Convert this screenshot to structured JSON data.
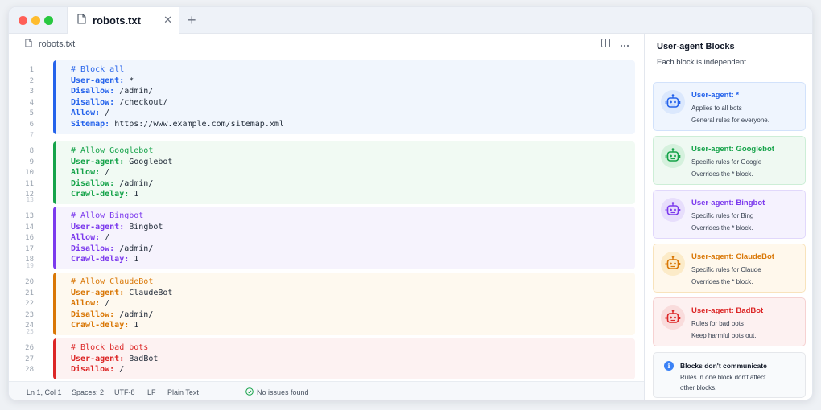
{
  "tab": {
    "title": "robots.txt",
    "close": "✕",
    "new": "+"
  },
  "breadcrumb": {
    "file": "robots.txt"
  },
  "colors": {
    "blue": "#2563eb",
    "green": "#16a34a",
    "purple": "#7c3aed",
    "orange": "#d97706",
    "red": "#dc2626"
  },
  "editor": {
    "blocks": [
      {
        "color": "blue",
        "lines": [
          {
            "n": "1",
            "comment": "# Block all"
          },
          {
            "n": "2",
            "key": "User-agent:",
            "value": " *"
          },
          {
            "n": "3",
            "key": "Disallow:",
            "value": " /admin/"
          },
          {
            "n": "4",
            "key": "Disallow:",
            "value": " /checkout/"
          },
          {
            "n": "5",
            "key": "Allow:",
            "value": " /"
          },
          {
            "n": "6",
            "key": "Sitemap:",
            "value": " https://www.example.com/sitemap.xml"
          }
        ]
      },
      {
        "color": "green",
        "lines": [
          {
            "n": "8",
            "comment": "# Allow Googlebot"
          },
          {
            "n": "9",
            "key": "User-agent:",
            "value": " Googlebot"
          },
          {
            "n": "10",
            "key": "Allow:",
            "value": " /"
          },
          {
            "n": "11",
            "key": "Disallow:",
            "value": " /admin/"
          },
          {
            "n": "12",
            "key": "Crawl-delay:",
            "value": " 1"
          }
        ]
      },
      {
        "color": "purple",
        "lines": [
          {
            "n": "13",
            "comment": "# Allow Bingbot"
          },
          {
            "n": "14",
            "key": "User-agent:",
            "value": " Bingbot"
          },
          {
            "n": "16",
            "key": "Allow:",
            "value": " /"
          },
          {
            "n": "17",
            "key": "Disallow:",
            "value": " /admin/"
          },
          {
            "n": "18",
            "key": "Crawl-delay:",
            "value": " 1"
          }
        ]
      },
      {
        "color": "orange",
        "lines": [
          {
            "n": "20",
            "comment": "# Allow ClaudeBot"
          },
          {
            "n": "21",
            "key": "User-agent:",
            "value": " ClaudeBot"
          },
          {
            "n": "22",
            "key": "Allow:",
            "value": " /"
          },
          {
            "n": "23",
            "key": "Disallow:",
            "value": " /admin/"
          },
          {
            "n": "24",
            "key": "Crawl-delay:",
            "value": " 1"
          }
        ]
      },
      {
        "color": "red",
        "lines": [
          {
            "n": "26",
            "comment": "# Block bad bots"
          },
          {
            "n": "27",
            "key": "User-agent:",
            "value": " BadBot"
          },
          {
            "n": "28",
            "key": "Disallow:",
            "value": " /"
          }
        ]
      }
    ],
    "gap_numbers": [
      "7",
      "13",
      "19",
      "25"
    ]
  },
  "status": {
    "position": "Ln 1, Col 1",
    "spaces": "Spaces: 2",
    "encoding": "UTF-8",
    "eol": "LF",
    "language": "Plain Text",
    "issues": "No issues found"
  },
  "panel": {
    "title": "User-agent Blocks",
    "subtitle": "Each block is independent",
    "cards": [
      {
        "color": "blue",
        "title": "User-agent: *",
        "line1": "Applies to all bots",
        "line2": "General rules for everyone."
      },
      {
        "color": "green",
        "title": "User-agent: Googlebot",
        "line1": "Specific rules for Google",
        "line2": "Overrides the * block."
      },
      {
        "color": "purple",
        "title": "User-agent: Bingbot",
        "line1": "Specific rules for Bing",
        "line2": "Overrides the * block."
      },
      {
        "color": "orange",
        "title": "User-agent: ClaudeBot",
        "line1": "Specific rules for Claude",
        "line2": "Overrides the * block."
      },
      {
        "color": "red",
        "title": "User-agent: BadBot",
        "line1": "Rules for bad bots",
        "line2": "Keep harmful bots out."
      }
    ],
    "note": {
      "icon": "i",
      "title": "Blocks don't communicate",
      "line1": "Rules in one block don't affect",
      "line2": "other blocks."
    }
  }
}
